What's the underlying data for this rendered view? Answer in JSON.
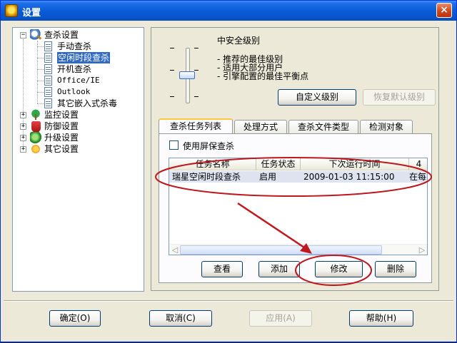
{
  "window": {
    "title": "设置",
    "close_glyph": "×",
    "app_icon": "rising-antivirus-icon"
  },
  "tree": {
    "items": [
      {
        "label": "查杀设置",
        "expander": "⊟",
        "icon": "scan-magnifier-icon"
      },
      {
        "label": "手动查杀",
        "icon": "document-icon"
      },
      {
        "label": "空闲时段查杀",
        "icon": "document-icon",
        "selected": true
      },
      {
        "label": "开机查杀",
        "icon": "document-icon"
      },
      {
        "label": "Office/IE",
        "icon": "document-icon"
      },
      {
        "label": "Outlook",
        "icon": "document-icon"
      },
      {
        "label": "其它嵌入式杀毒",
        "icon": "document-icon"
      },
      {
        "label": "监控设置",
        "expander": "⊞",
        "icon": "monitor-umbrella-icon"
      },
      {
        "label": "防御设置",
        "expander": "⊞",
        "icon": "defense-shield-icon"
      },
      {
        "label": "升级设置",
        "expander": "⊞",
        "icon": "upgrade-globe-icon"
      },
      {
        "label": "其它设置",
        "expander": "⊞",
        "icon": "other-settings-gear-icon"
      }
    ],
    "expand_plus": "+",
    "expand_minus": "−"
  },
  "level": {
    "title": "中安全级别",
    "descriptions": [
      "- 推荐的最佳级别",
      "- 适用大部分用户",
      "- 引擎配置的最佳平衡点"
    ],
    "slider_position": "2 of 4",
    "tick_glyph": "-",
    "custom_button": "自定义级别",
    "restore_button": "恢复默认级别"
  },
  "tabs": {
    "items": [
      "查杀任务列表",
      "处理方式",
      "查杀文件类型",
      "检测对象"
    ],
    "active_index": 0
  },
  "task_panel": {
    "screensaver_checkbox_label": "使用屏保查杀",
    "screensaver_checked": false,
    "columns": [
      "任务名称",
      "任务状态",
      "下次运行时间",
      "4"
    ],
    "rows": [
      {
        "name": "瑞星空闲时段查杀",
        "status": "启用",
        "next_run": "2009-01-03 11:15:00",
        "extra": "在每"
      }
    ],
    "scroll_left": "◁",
    "scroll_right": "▷",
    "buttons": {
      "view": "查看",
      "add": "添加",
      "modify": "修改",
      "delete": "删除"
    }
  },
  "footer": {
    "ok": "确定(O)",
    "cancel": "取消(C)",
    "apply": "应用(A)",
    "help": "帮助(H)"
  },
  "annotation": {
    "color": "#c0171c"
  }
}
